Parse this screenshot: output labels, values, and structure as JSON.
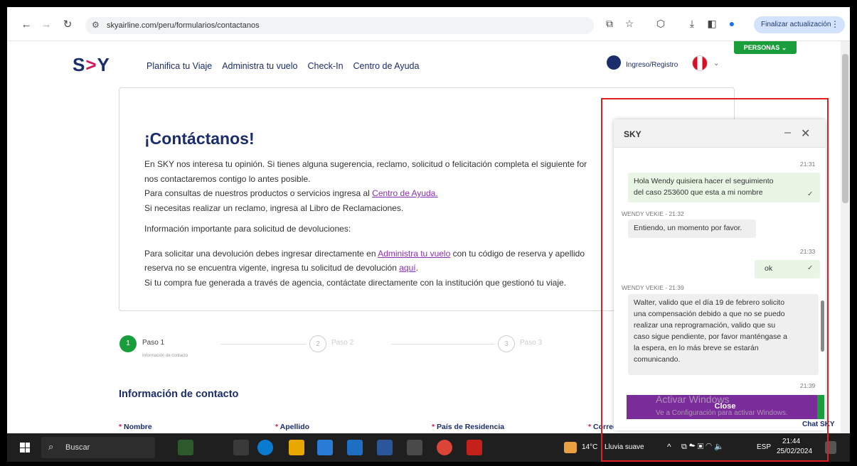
{
  "browser": {
    "url": "skyairline.com/peru/formularios/contactanos",
    "update_label": "Finalizar actualización"
  },
  "header": {
    "logo": "SKY",
    "nav": [
      "Planifica tu Viaje",
      "Administra tu vuelo",
      "Check-In",
      "Centro de Ayuda"
    ],
    "login": "Ingreso/Registro",
    "personas": "PERSONAS"
  },
  "card": {
    "title": "¡Contáctanos!",
    "line1": "En SKY nos interesa tu opinión. Si tienes alguna sugerencia, reclamo, solicitud o felicitación completa el siguiente for",
    "line2": "nos contactaremos contigo lo antes posible.",
    "line3_pre": "Para consultas de nuestros productos o servicios ingresa al ",
    "line3_link": "Centro de Ayuda.",
    "line4": "Si necesitas realizar un reclamo, ingresa al Libro de Reclamaciones.",
    "line5": "Información importante para solicitud de devoluciones:",
    "line6_pre": "Para solicitar una devolución debes ingresar directamente en ",
    "line6_link": "Administra tu vuelo",
    "line6_post": " con tu código de reserva y apellido",
    "line7_pre": "reserva no se encuentra vigente, ingresa tu solicitud de devolución ",
    "line7_link": "aquí",
    "line7_post": ".",
    "line8": "Si tu compra fue generada a través de agencia, contáctate directamente con la institución que gestionó tu viaje."
  },
  "steps": [
    {
      "num": "1",
      "label": "Paso 1",
      "sub": "Información de contacto"
    },
    {
      "num": "2",
      "label": "Paso 2",
      "sub": ""
    },
    {
      "num": "3",
      "label": "Paso 3",
      "sub": ""
    }
  ],
  "form": {
    "section_title": "Información de contacto",
    "fields": [
      "Nombre",
      "Apellido",
      "País de Residencia",
      "Correo Electrónico"
    ]
  },
  "chat": {
    "title": "SKY",
    "messages": [
      {
        "time": "21:31",
        "text_a": "Hola Wendy quisiera hacer el seguimiento",
        "text_b": "del caso 253600 que esta a mi nombre"
      },
      {
        "author": "WENDY VEKIE - 21:32",
        "text": "Entiendo, un momento por favor."
      },
      {
        "time": "21:33",
        "text": "ok"
      },
      {
        "author": "WENDY VEKIE - 21:39",
        "lines": [
          "Walter, valido que el día 19 de febrero solicito",
          "una compensación debido a que no se puedo",
          "realizar una reprogramación, valido que su",
          "caso sigue pendiente, por favor manténgase a",
          "la espera, en lo más breve se estarán",
          "comunicando."
        ]
      },
      {
        "time": "21:39"
      }
    ],
    "close_label": "Close",
    "launcher_label": "Chat SKY",
    "watermark_title": "Activar Windows",
    "watermark_sub": "Ve a Configuración para activar Windows."
  },
  "taskbar": {
    "search": "Buscar",
    "weather_temp": "14°C",
    "weather_desc": "Lluvia suave",
    "lang": "ESP",
    "time": "21:44",
    "date": "25/02/2024"
  }
}
